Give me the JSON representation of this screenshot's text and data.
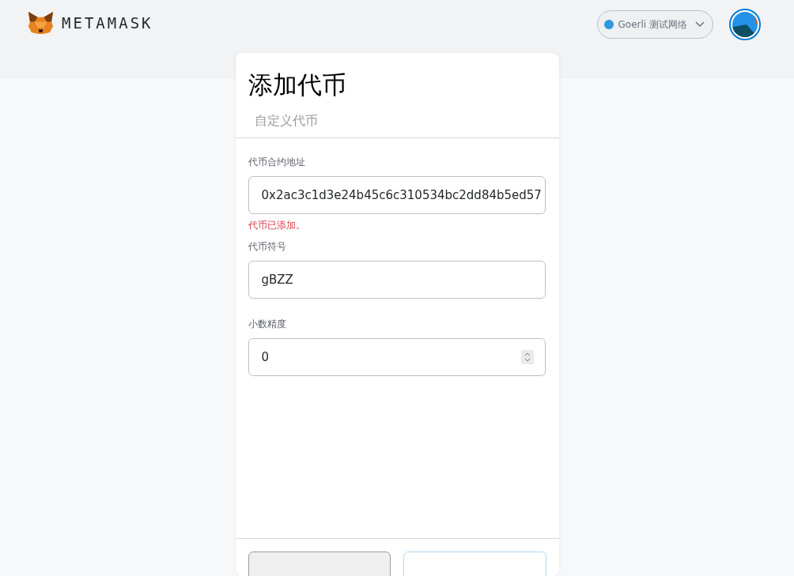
{
  "header": {
    "logo": "METAMASK",
    "network": {
      "label": "Goerli 测试网络",
      "color": "#3098dc"
    }
  },
  "card": {
    "title": "添加代币",
    "tabs": [
      {
        "label": "自定义代币",
        "selected": false
      }
    ],
    "fields": [
      {
        "kind": "text",
        "label": "代币合约地址",
        "value": "0x2ac3c1d3e24b45c6c310534bc2dd84b5ed57",
        "error": "代币已添加。"
      },
      {
        "kind": "text",
        "label": "代币符号",
        "value": "gBZZ"
      },
      {
        "kind": "number",
        "label": "小数精度",
        "value": "0"
      }
    ],
    "footer": {
      "buttons": [
        {
          "kind": "secondary"
        },
        {
          "kind": "primary"
        }
      ]
    }
  }
}
